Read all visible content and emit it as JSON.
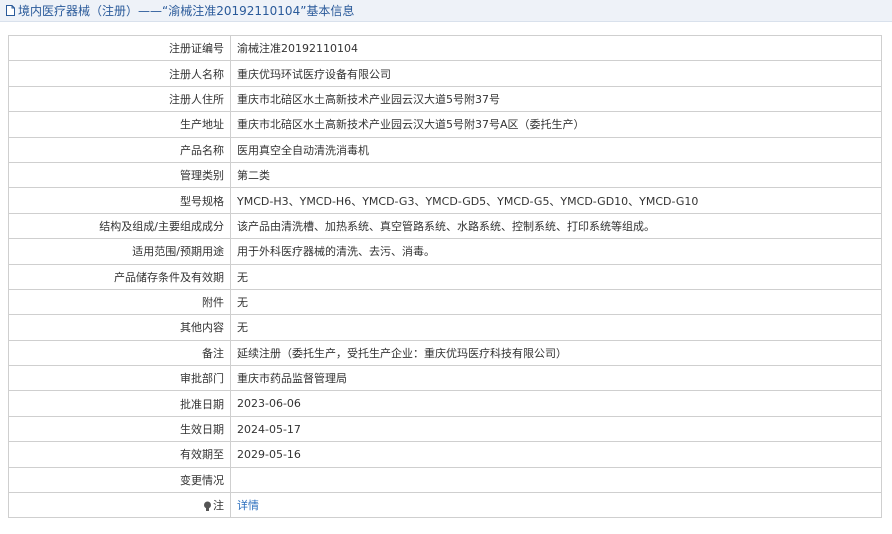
{
  "header": {
    "title": "境内医疗器械（注册）——“渝械注准20192110104”基本信息",
    "icon": "document-icon"
  },
  "rows": [
    {
      "label": "注册证编号",
      "value": "渝械注准20192110104"
    },
    {
      "label": "注册人名称",
      "value": "重庆优玛环试医疗设备有限公司"
    },
    {
      "label": "注册人住所",
      "value": "重庆市北碚区水土高新技术产业园云汉大道5号附37号"
    },
    {
      "label": "生产地址",
      "value": "重庆市北碚区水土高新技术产业园云汉大道5号附37号A区（委托生产）"
    },
    {
      "label": "产品名称",
      "value": "医用真空全自动清洗消毒机"
    },
    {
      "label": "管理类别",
      "value": "第二类"
    },
    {
      "label": "型号规格",
      "value": "YMCD-H3、YMCD-H6、YMCD-G3、YMCD-GD5、YMCD-G5、YMCD-GD10、YMCD-G10"
    },
    {
      "label": "结构及组成/主要组成成分",
      "value": "该产品由清洗槽、加热系统、真空管路系统、水路系统、控制系统、打印系统等组成。"
    },
    {
      "label": "适用范围/预期用途",
      "value": "用于外科医疗器械的清洗、去污、消毒。"
    },
    {
      "label": "产品储存条件及有效期",
      "value": "无"
    },
    {
      "label": "附件",
      "value": "无"
    },
    {
      "label": "其他内容",
      "value": "无"
    },
    {
      "label": "备注",
      "value": "延续注册（委托生产，受托生产企业：重庆优玛医疗科技有限公司）"
    },
    {
      "label": "审批部门",
      "value": "重庆市药品监督管理局"
    },
    {
      "label": "批准日期",
      "value": "2023-06-06"
    },
    {
      "label": "生效日期",
      "value": "2024-05-17"
    },
    {
      "label": "有效期至",
      "value": "2029-05-16"
    },
    {
      "label": "变更情况",
      "value": ""
    }
  ],
  "note": {
    "label": "注",
    "icon": "lightbulb-icon",
    "link_text": "详情"
  }
}
